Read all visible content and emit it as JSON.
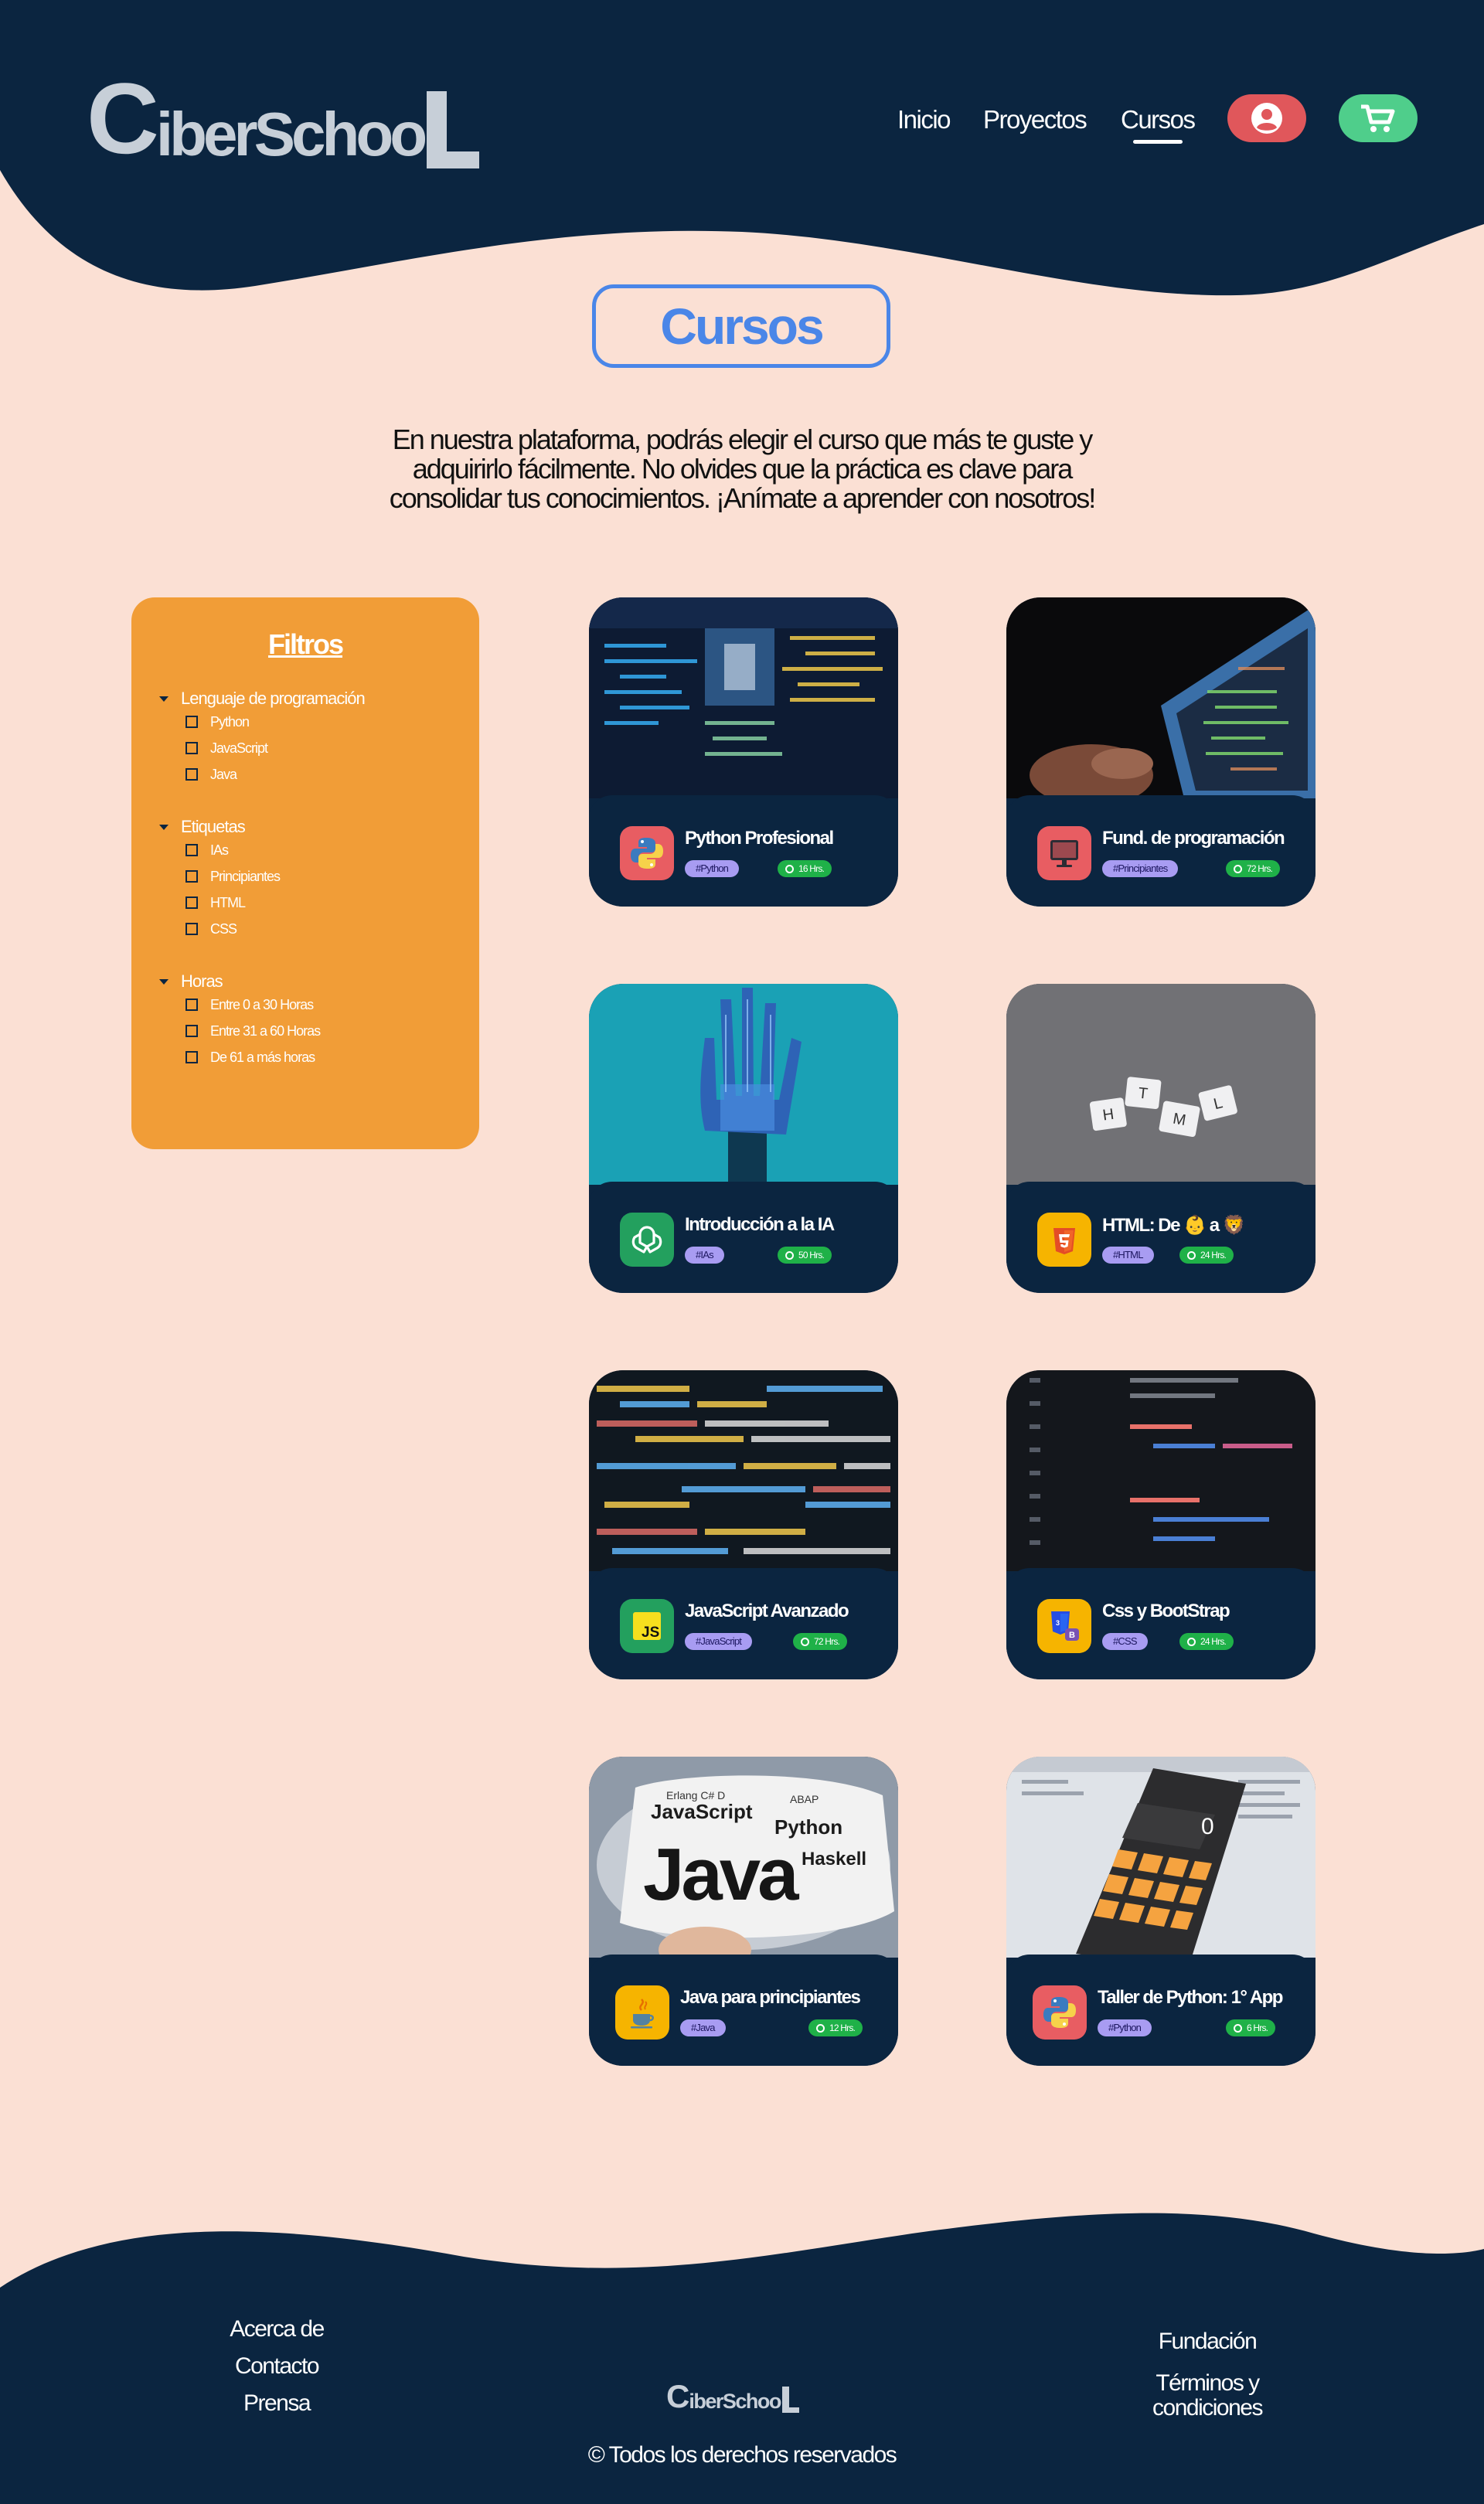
{
  "brand": {
    "logo_c": "C",
    "logo_middle": "iberSchoo",
    "logo_l": "L"
  },
  "nav": {
    "items": [
      {
        "label": "Inicio"
      },
      {
        "label": "Proyectos"
      },
      {
        "label": "Cursos",
        "active": true
      }
    ],
    "user_icon": "user-circle-icon",
    "cart_icon": "cart-icon"
  },
  "page": {
    "title": "Cursos",
    "intro": "En nuestra plataforma, podrás elegir el curso que más te guste y adquirirlo fácilmente. No olvides que la práctica es clave para consolidar tus conocimientos. ¡Anímate a aprender con nosotros!"
  },
  "filters": {
    "title": "Filtros",
    "groups": [
      {
        "title": "Lenguaje de programación",
        "options": [
          "Python",
          "JavaScript",
          "Java"
        ]
      },
      {
        "title": "Etiquetas",
        "options": [
          "IAs",
          "Principiantes",
          "HTML",
          "CSS"
        ]
      },
      {
        "title": "Horas",
        "options": [
          "Entre 0 a 30 Horas",
          "Entre 31 a 60 Horas",
          "De 61 a más horas"
        ]
      }
    ]
  },
  "courses": [
    {
      "name": "Python Profesional",
      "tag": "#Python",
      "hours": "16 Hrs.",
      "icon": "python-icon"
    },
    {
      "name": "Fund. de programación",
      "tag": "#Principiantes",
      "hours": "72 Hrs.",
      "icon": "computer-monitor-icon"
    },
    {
      "name": "Introducción a la IA",
      "tag": "#IAs",
      "hours": "50 Hrs.",
      "icon": "openai-icon"
    },
    {
      "name": "HTML: De 👶 a 🦁",
      "tag": "#HTML",
      "hours": "24 Hrs.",
      "icon": "html5-icon"
    },
    {
      "name": "JavaScript Avanzado",
      "tag": "#JavaScript",
      "hours": "72 Hrs.",
      "icon": "javascript-icon"
    },
    {
      "name": "Css y BootStrap",
      "tag": "#CSS",
      "hours": "24 Hrs.",
      "icon": "css3-bootstrap-icon"
    },
    {
      "name": "Java para principiantes",
      "tag": "#Java",
      "hours": "12 Hrs.",
      "icon": "java-icon"
    },
    {
      "name": "Taller de Python: 1° App",
      "tag": "#Python",
      "hours": "6 Hrs.",
      "icon": "python-icon"
    }
  ],
  "footer": {
    "left_links": [
      "Acerca de",
      "Contacto",
      "Prensa"
    ],
    "right_links": [
      "Fundación",
      "Términos y condiciones"
    ],
    "copyright": "© Todos los derechos reservados"
  },
  "colors": {
    "navy": "#0b2540",
    "background": "#fbe0d4",
    "accent_blue": "#4a86e8",
    "filters_orange": "#f19d37",
    "user_red": "#e0575b",
    "cart_green": "#4fce8b",
    "tag_purple": "#a89cf2",
    "hours_green": "#1fb148"
  }
}
